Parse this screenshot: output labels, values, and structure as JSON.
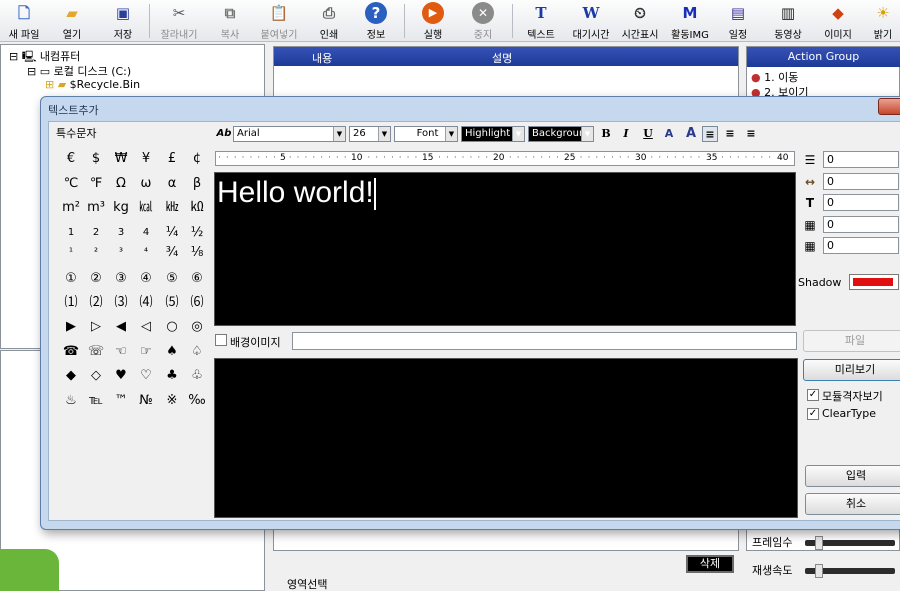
{
  "toolbar": {
    "buttons": [
      {
        "label": "새 파일",
        "icon": "new-file-icon"
      },
      {
        "label": "열기",
        "icon": "folder-open-icon"
      },
      {
        "label": "저장",
        "icon": "save-disk-icon"
      },
      {
        "label": "잘라내기",
        "icon": "scissors-icon",
        "disabled": true
      },
      {
        "label": "복사",
        "icon": "copy-icon",
        "disabled": true
      },
      {
        "label": "붙여넣기",
        "icon": "paste-icon",
        "disabled": true
      },
      {
        "label": "인쇄",
        "icon": "printer-icon"
      },
      {
        "label": "정보",
        "icon": "help-icon"
      },
      {
        "label": "실행",
        "icon": "play-icon"
      },
      {
        "label": "중지",
        "icon": "stop-icon",
        "disabled": true
      },
      {
        "label": "텍스트",
        "icon": "text-tool-icon"
      },
      {
        "label": "대기시간",
        "icon": "wait-time-icon"
      },
      {
        "label": "시간표시",
        "icon": "clock-display-icon"
      },
      {
        "label": "활동IMG",
        "icon": "activity-image-icon"
      },
      {
        "label": "일정",
        "icon": "schedule-icon"
      },
      {
        "label": "동영상",
        "icon": "video-icon"
      },
      {
        "label": "이미지",
        "icon": "image-icon"
      },
      {
        "label": "밝기",
        "icon": "brightness-icon"
      }
    ]
  },
  "tree": {
    "items": [
      "내컴퓨터",
      "로컬 디스크 (C:)",
      "$Recycle.Bin"
    ]
  },
  "grid": {
    "col_content": "내용",
    "col_desc": "설명"
  },
  "action_group": {
    "title": "Action Group",
    "items": [
      "1. 이동",
      "2. 보이기"
    ]
  },
  "dialog": {
    "title": "텍스트추가",
    "special_chars": {
      "title": "특수문자",
      "rows": [
        [
          "€",
          "$",
          "₩",
          "¥",
          "£",
          "¢"
        ],
        [
          "℃",
          "℉",
          "Ω",
          "ω",
          "α",
          "β"
        ],
        [
          "m²",
          "m³",
          "kg",
          "㎉",
          "㎑",
          "㏀"
        ],
        [
          "1",
          "2",
          "3",
          "4",
          "¼",
          "½"
        ],
        [
          "¹",
          "²",
          "³",
          "⁴",
          "¾",
          "⅛"
        ],
        [
          "①",
          "②",
          "③",
          "④",
          "⑤",
          "⑥"
        ],
        [
          "⑴",
          "⑵",
          "⑶",
          "⑷",
          "⑸",
          "⑹"
        ],
        [
          "▶",
          "▷",
          "◀",
          "◁",
          "○",
          "◎"
        ],
        [
          "☎",
          "☏",
          "☜",
          "☞",
          "♠",
          "♤"
        ],
        [
          "◆",
          "◇",
          "♥",
          "♡",
          "♣",
          "♧"
        ],
        [
          "♨",
          "℡",
          "™",
          "№",
          "※",
          "‰"
        ]
      ]
    },
    "format": {
      "font_name": "Arial",
      "font_size": "26",
      "font_btn": "Font",
      "highlight_btn": "Highlight",
      "background_btn": "Background",
      "bold": "B",
      "italic": "I",
      "underline": "U"
    },
    "ruler": [
      "5",
      "10",
      "15",
      "20",
      "25",
      "30",
      "35",
      "40"
    ],
    "editor_text": "Hello world!",
    "spinners": [
      "0",
      "0",
      "0",
      "0",
      "0"
    ],
    "shadow_label": "Shadow",
    "bg_image_label": "배경이미지",
    "file_btn": "파일",
    "preview_btn": "미리보기",
    "module_grid_label": "모듈격자보기",
    "clear_type_label": "ClearType",
    "enter_btn": "입력",
    "cancel_btn": "취소"
  },
  "bottom": {
    "delete_btn": "삭제",
    "area_select": "영역선택",
    "frame_rate_label": "프레임수",
    "play_speed_label": "재생속도"
  }
}
